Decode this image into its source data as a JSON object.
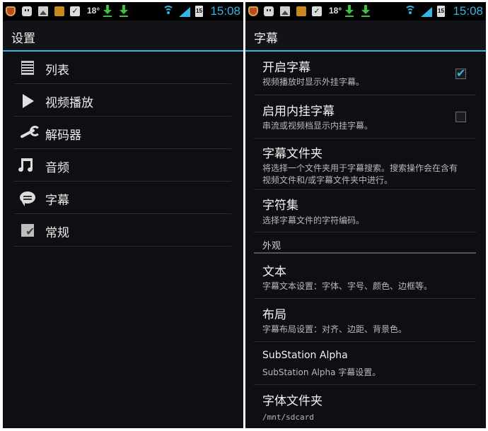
{
  "statusbar": {
    "temperature": "18°",
    "battery": "15",
    "time": "15:08"
  },
  "left_screen": {
    "title": "设置",
    "items": [
      {
        "label": "列表",
        "icon": "list-icon"
      },
      {
        "label": "视频播放",
        "icon": "play-icon"
      },
      {
        "label": "解码器",
        "icon": "wrench-icon"
      },
      {
        "label": "音频",
        "icon": "music-note-icon"
      },
      {
        "label": "字幕",
        "icon": "speech-bubble-icon"
      },
      {
        "label": "常规",
        "icon": "general-settings-icon"
      }
    ]
  },
  "right_screen": {
    "title": "字幕",
    "prefs": [
      {
        "title": "开启字幕",
        "summary": "视频播放时显示外挂字幕。",
        "checked": true
      },
      {
        "title": "启用内挂字幕",
        "summary": "串流或视频档显示内挂字幕。",
        "checked": false
      },
      {
        "title": "字幕文件夹",
        "summary": "将选择一个文件夹用于字幕搜索。搜索操作会在含有视频文件和/或字幕文件夹中进行。"
      },
      {
        "title": "字符集",
        "summary": "选择字幕文件的字符编码。"
      }
    ],
    "category": "外观",
    "appearance": [
      {
        "title": "文本",
        "summary": "字幕文本设置：字体、字号、颜色、边框等。"
      },
      {
        "title": "布局",
        "summary": "字幕布局设置：对齐、边距、背景色。"
      },
      {
        "title": "SubStation Alpha",
        "summary": "SubStation Alpha 字幕设置。"
      },
      {
        "title": "字体文件夹",
        "summary": "/mnt/sdcard"
      }
    ]
  },
  "colors": {
    "accent": "#33b5e5",
    "background": "#0e0f12",
    "download": "#3fbf3f"
  }
}
